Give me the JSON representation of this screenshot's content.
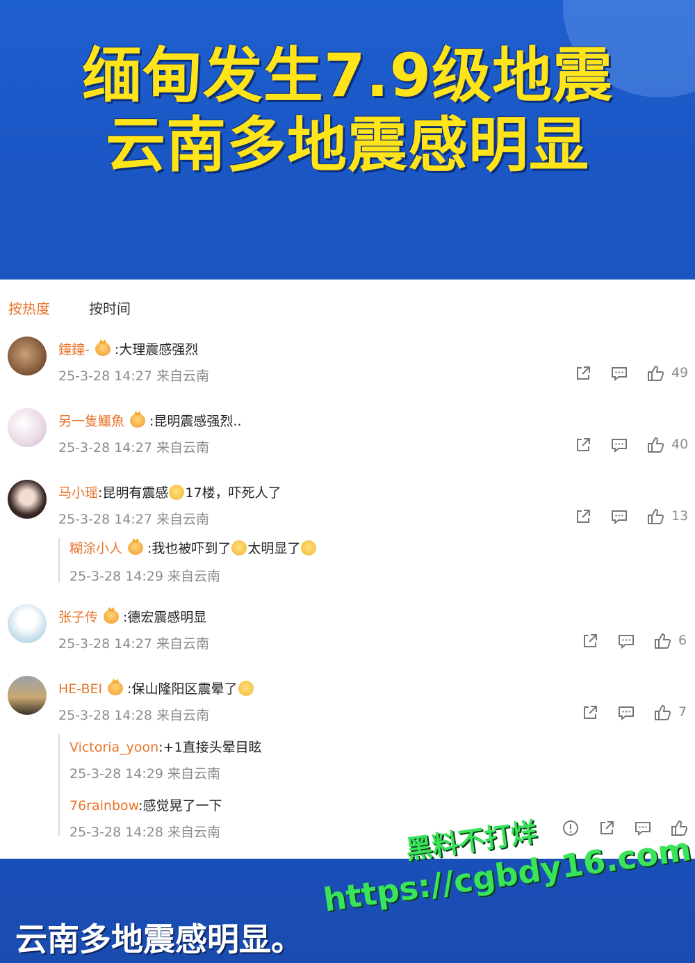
{
  "headline": {
    "line1": "缅甸发生7.9级地震",
    "line2": "云南多地震感明显"
  },
  "tabs": {
    "hot": "按热度",
    "time": "按时间"
  },
  "comments": [
    {
      "user": "鐘鐘-",
      "text": ":大理震感强烈",
      "meta": "25-3-28 14:27 来自云南",
      "likes": "49"
    },
    {
      "user": "另一隻鱷魚",
      "text": ":昆明震感强烈..",
      "meta": "25-3-28 14:27 来自云南",
      "likes": "40"
    },
    {
      "user": "马小瑶",
      "text_a": ":昆明有震感",
      "text_b": "17楼，吓死人了",
      "meta": "25-3-28 14:27 来自云南",
      "likes": "13",
      "reply": {
        "user": "糊涂小人",
        "text_a": ":我也被吓到了",
        "text_b": "太明显了",
        "meta": "25-3-28 14:29 来自云南"
      }
    },
    {
      "user": "张子传",
      "text": ":德宏震感明显",
      "meta": "25-3-28 14:27 来自云南",
      "likes": "6"
    },
    {
      "user": "HE-BEI",
      "text": ":保山隆阳区震晕了",
      "meta": "25-3-28 14:28 来自云南",
      "likes": "7",
      "replies": [
        {
          "user": "Victoria_yoon",
          "text": ":+1直接头晕目眩",
          "meta": "25-3-28 14:29 来自云南"
        },
        {
          "user": "76rainbow",
          "text": ":感觉晃了一下",
          "meta": "25-3-28 14:28 来自云南"
        }
      ]
    }
  ],
  "bottom": {
    "caption": "云南多地震感明显。"
  },
  "watermark": {
    "line1": "黑料不打烊",
    "line2": "https://cgbdy16.com"
  },
  "colors": {
    "accent_orange": "#e8742a",
    "headline_yellow": "#ffe41a",
    "watermark_green": "#39e35a",
    "banner_blue": "#1e5fcf"
  }
}
